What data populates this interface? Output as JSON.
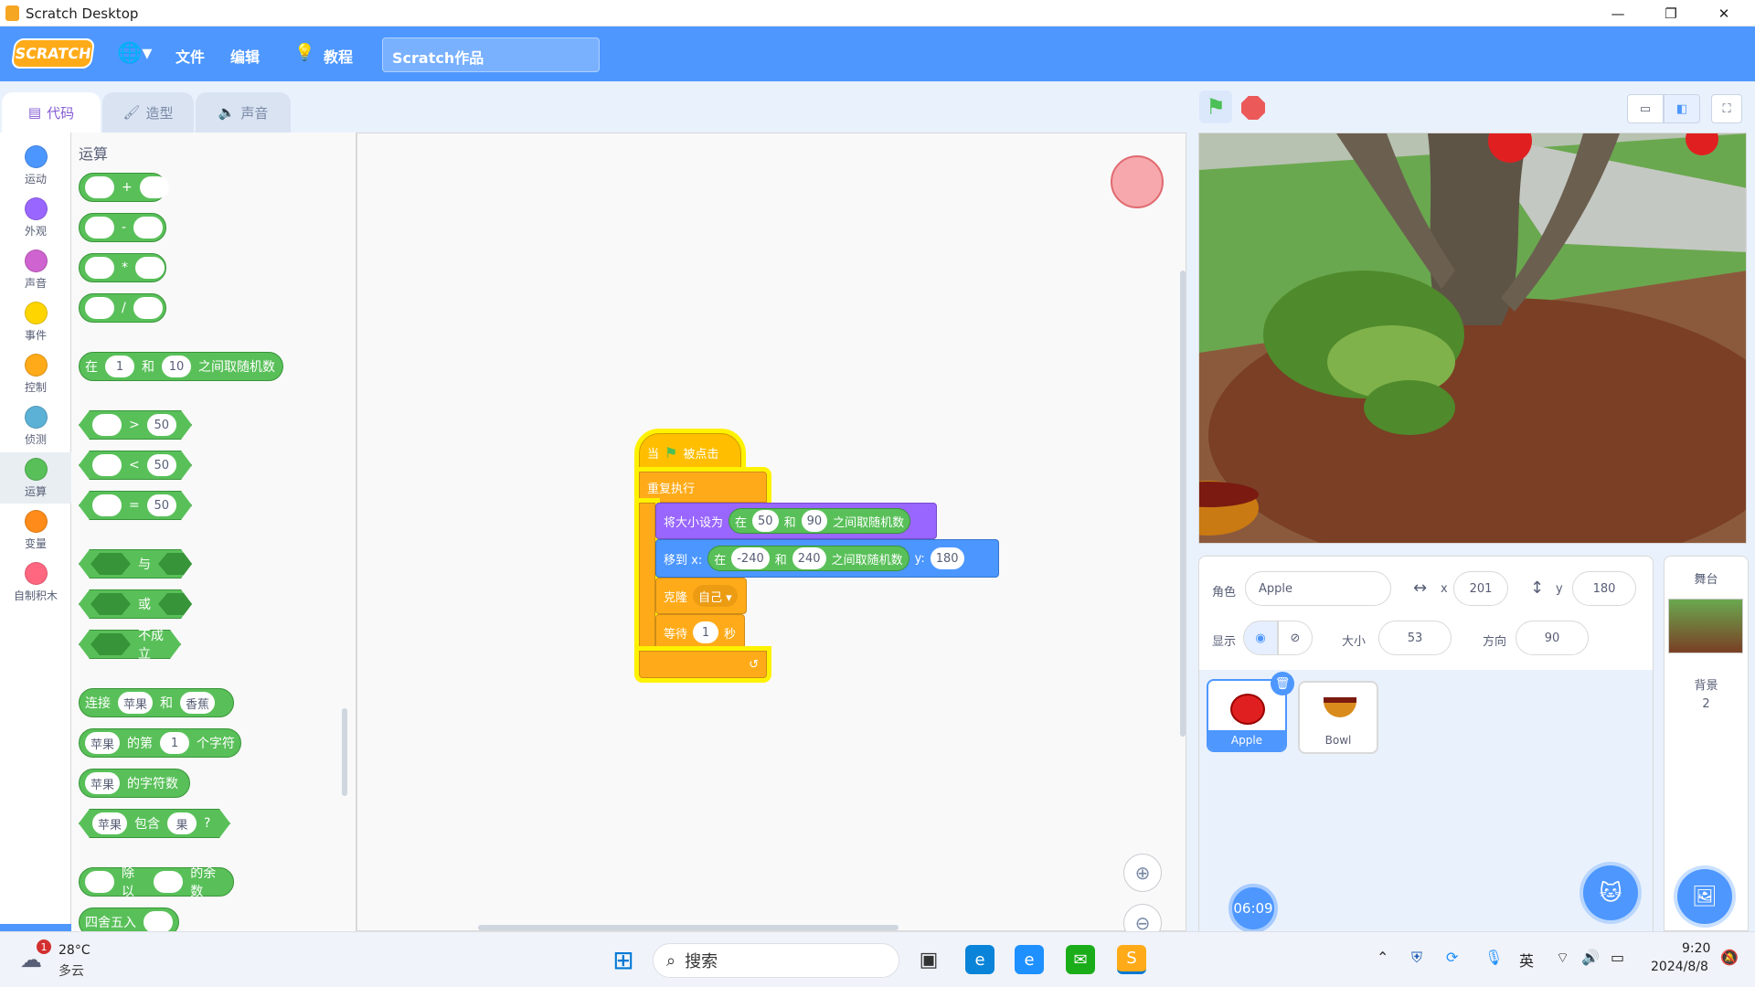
{
  "window": {
    "title": "Scratch Desktop",
    "minimize": "—",
    "restore": "❐",
    "close": "✕"
  },
  "menu": {
    "logo": "SCRATCH",
    "globe": "🌐▾",
    "file": "文件",
    "edit": "编辑",
    "tutorials": "教程",
    "project_title": "Scratch作品"
  },
  "tabs": {
    "code": "代码",
    "costumes": "造型",
    "sounds": "声音"
  },
  "categories": [
    {
      "label": "运动",
      "color": "#4c97ff"
    },
    {
      "label": "外观",
      "color": "#9966ff"
    },
    {
      "label": "声音",
      "color": "#cf63cf"
    },
    {
      "label": "事件",
      "color": "#ffd500"
    },
    {
      "label": "控制",
      "color": "#ffab19"
    },
    {
      "label": "侦测",
      "color": "#5cb1d6"
    },
    {
      "label": "运算",
      "color": "#59c059"
    },
    {
      "label": "变量",
      "color": "#ff8c1a"
    },
    {
      "label": "自制积木",
      "color": "#ff6680"
    }
  ],
  "palette": {
    "title": "运算",
    "add": "+",
    "sub": "-",
    "mul": "*",
    "div": "/",
    "random_pre": "在",
    "random_a": "1",
    "random_mid": "和",
    "random_b": "10",
    "random_post": "之间取随机数",
    "gt": ">",
    "lt": "<",
    "eq": "=",
    "cmp_val": "50",
    "and": "与",
    "or": "或",
    "not": "不成立",
    "join_pre": "连接",
    "join_a": "苹果",
    "join_mid": "和",
    "join_b": "香蕉",
    "letter_a": "苹果",
    "letter_mid": "的第",
    "letter_n": "1",
    "letter_post": "个字符",
    "length_a": "苹果",
    "length_post": "的字符数",
    "contains_a": "苹果",
    "contains_mid": "包含",
    "contains_b": "果",
    "contains_q": "?",
    "mod_mid": "除以",
    "mod_post": "的余数",
    "round": "四舍五入"
  },
  "script": {
    "when": "当",
    "flag_clicked": "被点击",
    "forever": "重复执行",
    "set_size": "将大小设为",
    "r1_pre": "在",
    "r1_a": "50",
    "r1_mid": "和",
    "r1_b": "90",
    "r1_post": "之间取随机数",
    "goto": "移到 x:",
    "r2_pre": "在",
    "r2_a": "-240",
    "r2_mid": "和",
    "r2_b": "240",
    "r2_post": "之间取随机数",
    "y_label": "y:",
    "y_val": "180",
    "clone": "克隆",
    "clone_target": "自己 ▾",
    "wait": "等待",
    "wait_val": "1",
    "wait_unit": "秒"
  },
  "sprite_info": {
    "sprite_label": "角色",
    "sprite_name": "Apple",
    "x_label": "x",
    "x_val": "201",
    "y_label": "y",
    "y_val": "180",
    "show_label": "显示",
    "size_label": "大小",
    "size_val": "53",
    "dir_label": "方向",
    "dir_val": "90"
  },
  "sprites": [
    {
      "name": "Apple"
    },
    {
      "name": "Bowl"
    }
  ],
  "stage_pane": {
    "title": "舞台",
    "backdrops_label": "背景",
    "backdrops_count": "2"
  },
  "timer": "06:09",
  "taskbar": {
    "weather_temp": "28°C",
    "weather_desc": "多云",
    "weather_badge": "1",
    "search": "搜索",
    "ime": "英",
    "time": "9:20",
    "date": "2024/8/8"
  }
}
